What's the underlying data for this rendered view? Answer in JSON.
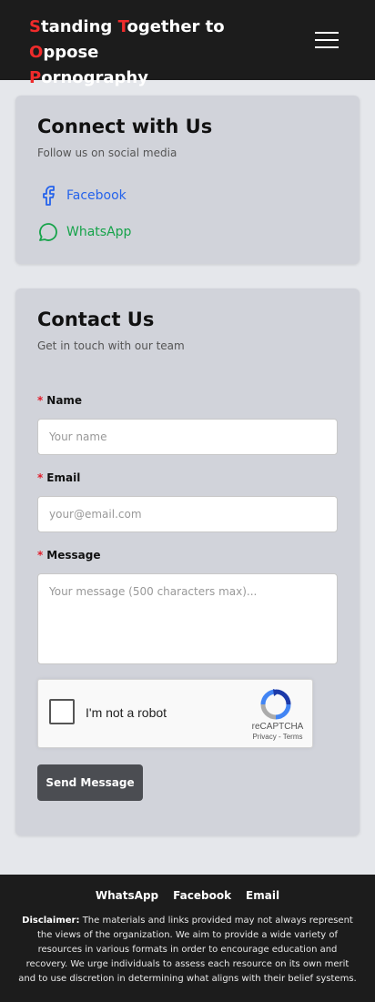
{
  "header": {
    "brand": [
      {
        "cap": "S",
        "rest": "tanding "
      },
      {
        "cap": "T",
        "rest": "ogether to "
      },
      {
        "cap": "O",
        "rest": "ppose"
      },
      {
        "cap": "P",
        "rest": "ornography"
      }
    ],
    "menu_icon": "hamburger-icon"
  },
  "connect": {
    "title": "Connect with Us",
    "subtitle": "Follow us on social media",
    "links": [
      {
        "label": "Facebook",
        "icon": "facebook-icon",
        "color": "#2563eb"
      },
      {
        "label": "WhatsApp",
        "icon": "whatsapp-icon",
        "color": "#16a34a"
      }
    ]
  },
  "contact": {
    "title": "Contact Us",
    "subtitle": "Get in touch with our team",
    "required_mark": "*",
    "fields": {
      "name": {
        "label": "Name",
        "placeholder": "Your name"
      },
      "email": {
        "label": "Email",
        "placeholder": "your@email.com"
      },
      "message": {
        "label": "Message",
        "placeholder": "Your message (500 characters max)..."
      }
    },
    "recaptcha": {
      "label": "I'm not a robot",
      "brand": "reCAPTCHA",
      "terms": "Privacy - Terms"
    },
    "submit_label": "Send Message"
  },
  "footer": {
    "links": [
      "WhatsApp",
      "Facebook",
      "Email"
    ],
    "disclaimer_label": "Disclaimer:",
    "disclaimer_text": "The materials and links provided may not always represent the views of the organization. We aim to provide a wide variety of resources in various formats in order to encourage education and recovery. We urge individuals to assess each resource on its own merit and to use discretion in determining what aligns with their belief systems."
  },
  "colors": {
    "accent_red": "#ef2b2b",
    "header_bg": "#1c1c1c",
    "card_bg": "#d1d3da",
    "button_bg": "#4b4d52"
  }
}
